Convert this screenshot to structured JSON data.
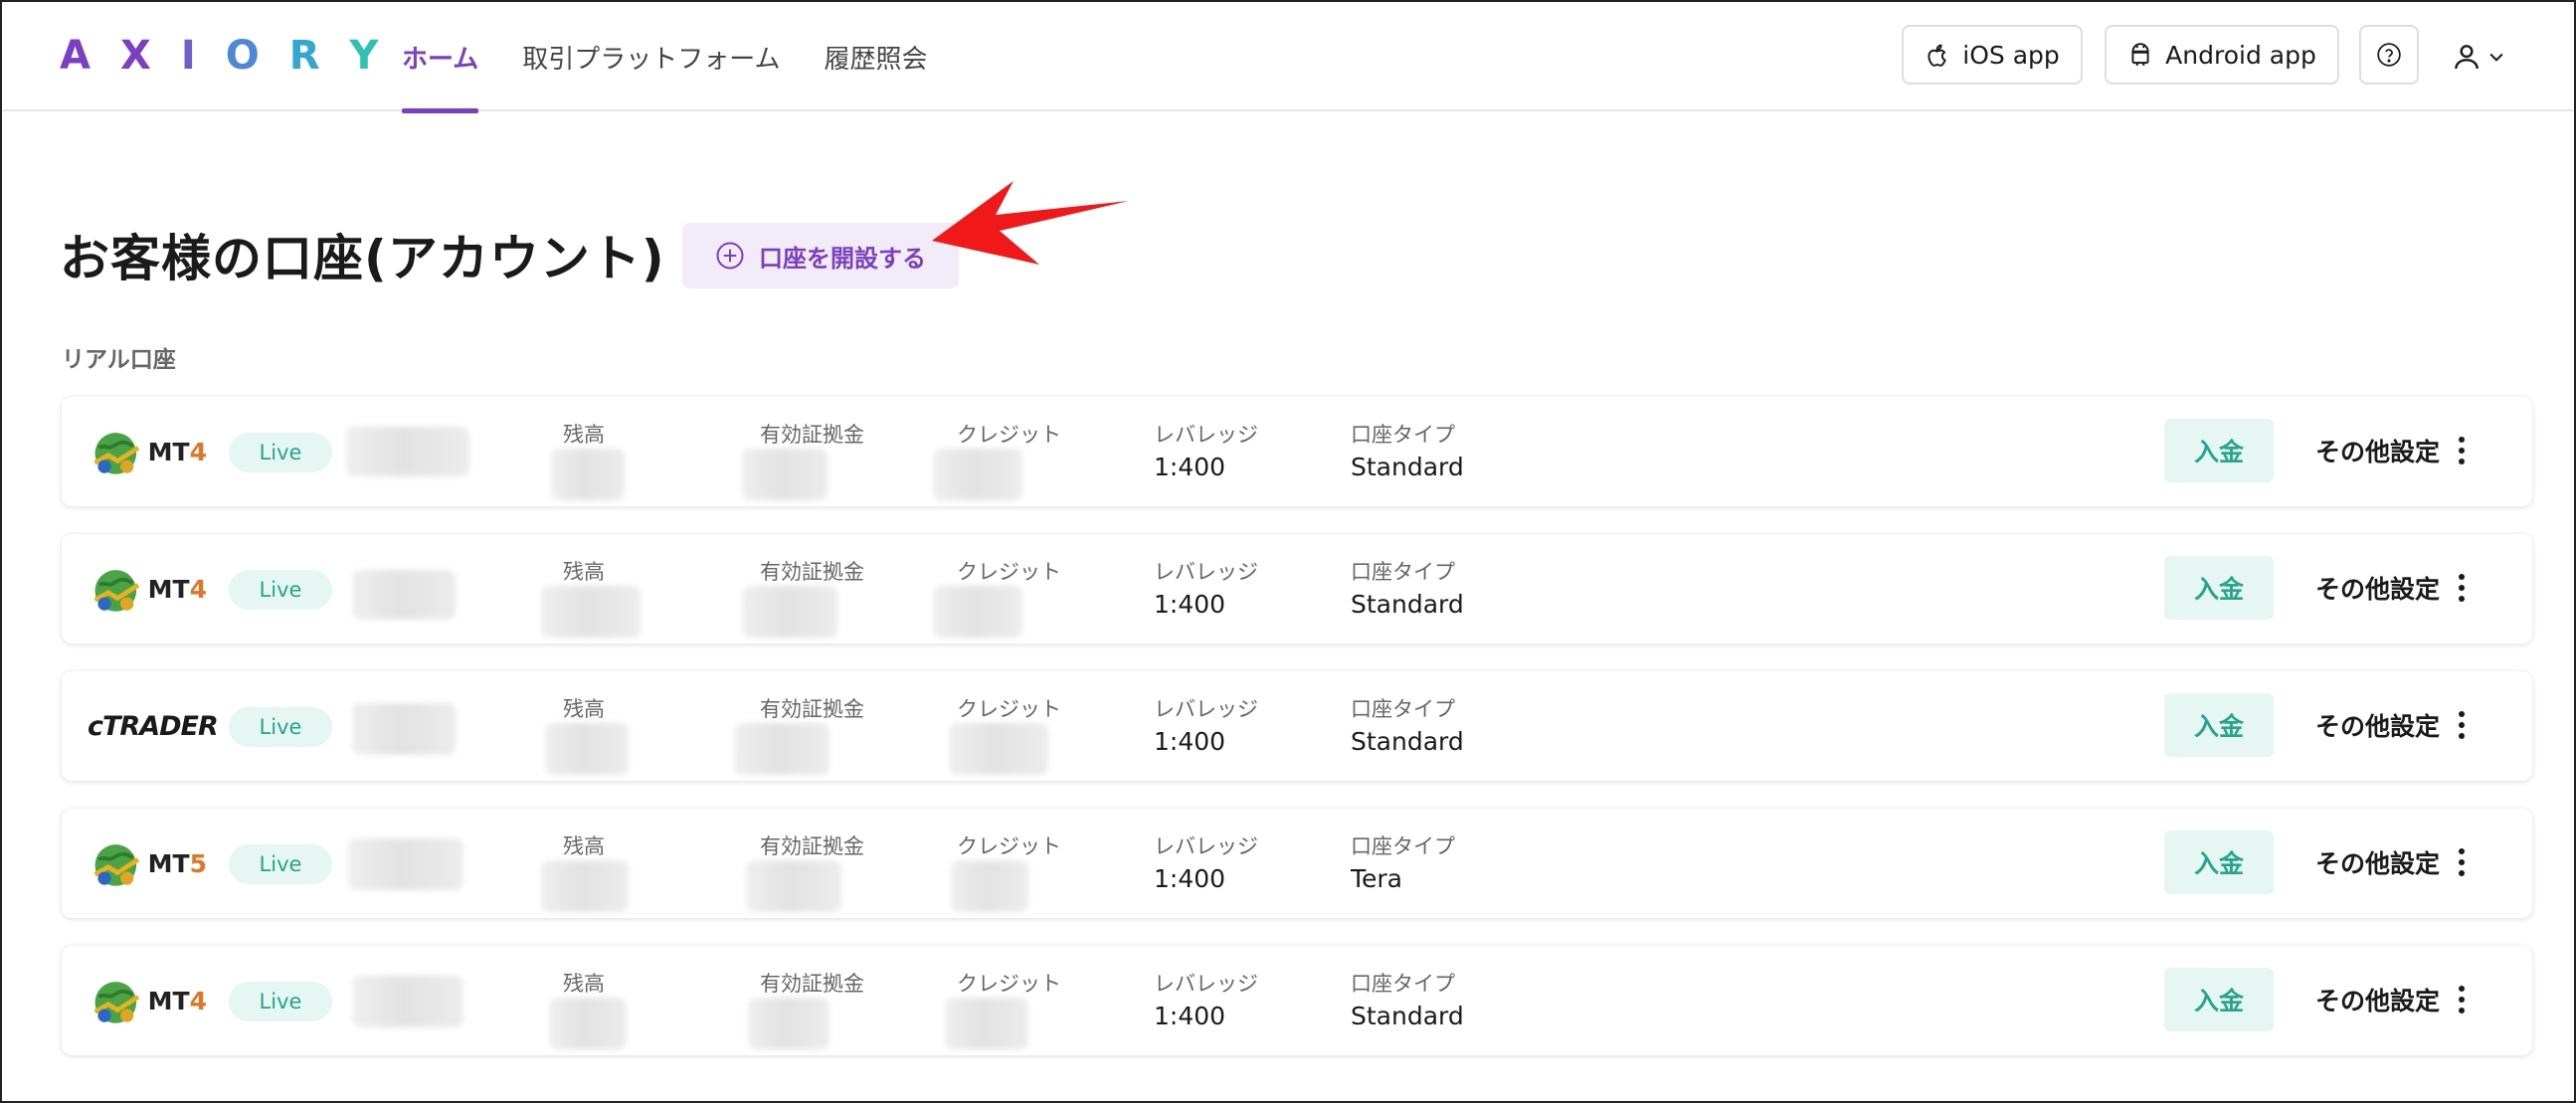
{
  "header": {
    "logo": [
      "A",
      "X",
      "I",
      "O",
      "R",
      "Y"
    ],
    "logo_colors": [
      "#7a3fc2",
      "#7a3fc2",
      "#6a5fcc",
      "#4f86d6",
      "#33a8cf",
      "#2fc1b3"
    ],
    "nav": [
      "ホーム",
      "取引プラットフォーム",
      "履歴照会"
    ],
    "ios_label": "iOS app",
    "android_label": "Android app"
  },
  "main": {
    "title": "お客様の口座(アカウント)",
    "open_account_label": "口座を開設する",
    "section_label": "リアル口座"
  },
  "labels": {
    "live": "Live",
    "balance": "残高",
    "margin": "有効証拠金",
    "credit": "クレジット",
    "leverage": "レバレッジ",
    "account_type": "口座タイプ",
    "deposit": "入金",
    "other_settings": "その他設定"
  },
  "accounts": [
    {
      "platform": "MT",
      "version": "4",
      "leverage": "1:400",
      "account_type": "Standard"
    },
    {
      "platform": "MT",
      "version": "4",
      "leverage": "1:400",
      "account_type": "Standard"
    },
    {
      "platform": "cTRADER",
      "version": "",
      "leverage": "1:400",
      "account_type": "Standard"
    },
    {
      "platform": "MT",
      "version": "5",
      "leverage": "1:400",
      "account_type": "Tera"
    },
    {
      "platform": "MT",
      "version": "4",
      "leverage": "1:400",
      "account_type": "Standard"
    }
  ],
  "colors": {
    "accent": "#7a3fc2",
    "accent_bg": "#f2ebf8",
    "live_green": "#27a58a",
    "live_bg": "#e6f6f3",
    "arrow_red": "#f01818"
  }
}
